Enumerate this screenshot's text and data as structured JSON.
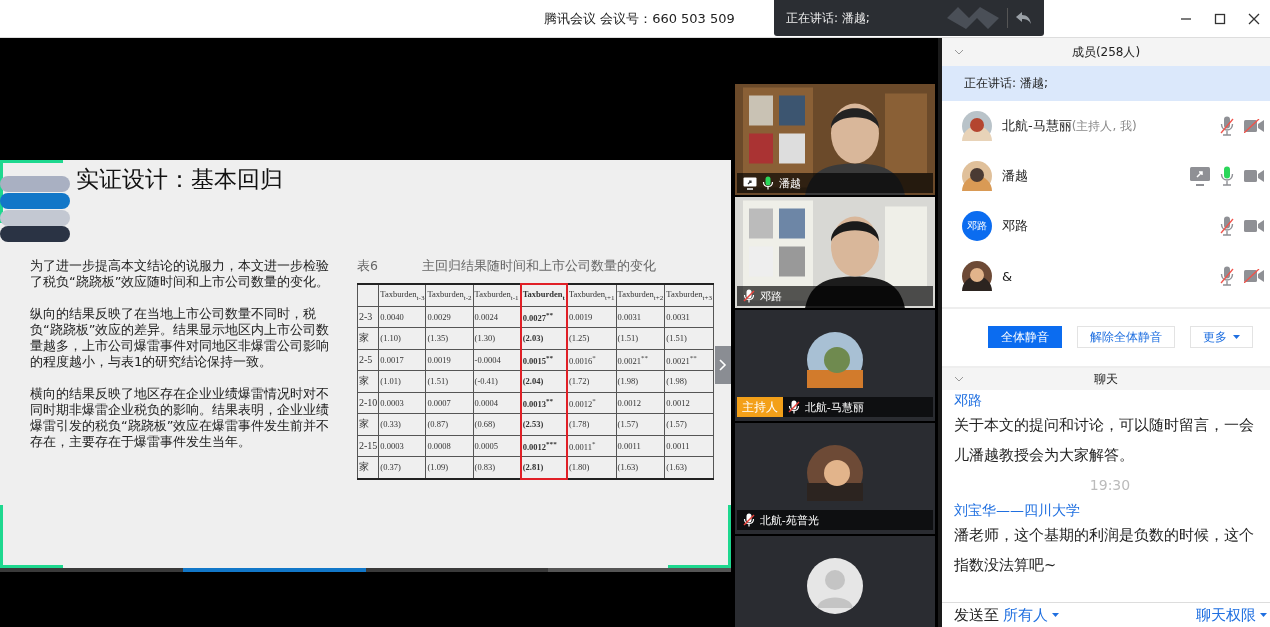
{
  "title_bar": {
    "title": "腾讯会议 会议号：660 503 509",
    "speaking_toast": "正在讲话: 潘越;"
  },
  "slide": {
    "title": "实证设计：基本回归",
    "paragraphs": [
      "为了进一步提高本文结论的说服力，本文进一步检验了税负“跷跷板”效应随时间和上市公司数量的变化。",
      "纵向的结果反映了在当地上市公司数量不同时，税负“跷跷板”效应的差异。结果显示地区内上市公司数量越多，上市公司爆雷事件对同地区非爆雷公司影响的程度越小，与表1的研究结论保持一致。",
      "横向的结果反映了地区存在企业业绩爆雷情况时对不同时期非爆雷企业税负的影响。结果表明，企业业绩爆雷引发的税负“跷跷板”效应在爆雷事件发生前并不存在，主要存在于爆雷事件发生当年。"
    ],
    "table": {
      "label": "表6",
      "caption": "主回归结果随时间和上市公司数量的变化",
      "columns": [
        {
          "label": "Taxburden$_{t-3}$",
          "highlighted": false
        },
        {
          "label": "Taxburden$_{t-2}$",
          "highlighted": false
        },
        {
          "label": "Taxburden$_{t-1}$",
          "highlighted": false
        },
        {
          "label": "Taxburden$_{t}$",
          "highlighted": true
        },
        {
          "label": "Taxburden$_{t+1}$",
          "highlighted": false
        },
        {
          "label": "Taxburden$_{t+2}$",
          "highlighted": false
        },
        {
          "label": "Taxburden$_{t+3}$",
          "highlighted": false
        }
      ],
      "rows": [
        {
          "label": "2-3",
          "cells": [
            "0.0040",
            "0.0029",
            "0.0024",
            "0.0027$^{**}$",
            "0.0019",
            "0.0031",
            "0.0031"
          ]
        },
        {
          "label": "家",
          "cells": [
            "(1.10)",
            "(1.35)",
            "(1.30)",
            "(2.03)",
            "(1.25)",
            "(1.51)",
            "(1.51)"
          ]
        },
        {
          "label": "2-5",
          "cells": [
            "0.0017",
            "0.0019",
            "-0.0004",
            "0.0015$^{**}$",
            "0.0016$^{*}$",
            "0.0021$^{**}$",
            "0.0021$^{**}$"
          ]
        },
        {
          "label": "家",
          "cells": [
            "(1.01)",
            "(1.51)",
            "(-0.41)",
            "(2.04)",
            "(1.72)",
            "(1.98)",
            "(1.98)"
          ]
        },
        {
          "label": "2-10",
          "cells": [
            "0.0003",
            "0.0007",
            "0.0004",
            "0.0013$^{**}$",
            "0.0012$^{*}$",
            "0.0012",
            "0.0012"
          ]
        },
        {
          "label": "家",
          "cells": [
            "(0.33)",
            "(0.87)",
            "(0.68)",
            "(2.53)",
            "(1.78)",
            "(1.57)",
            "(1.57)"
          ]
        },
        {
          "label": "2-15",
          "cells": [
            "0.0003",
            "0.0008",
            "0.0005",
            "0.0012$^{***}$",
            "0.0011$^{*}$",
            "0.0011",
            "0.0011"
          ]
        },
        {
          "label": "家",
          "cells": [
            "(0.37)",
            "(1.09)",
            "(0.83)",
            "(2.81)",
            "(1.80)",
            "(1.63)",
            "(1.63)"
          ]
        }
      ]
    }
  },
  "video_tiles": [
    {
      "kind": "camera",
      "name": "潘越",
      "sharing": true,
      "muted": false,
      "speaking": true
    },
    {
      "kind": "camera",
      "name": "邓路",
      "sharing": false,
      "muted": true,
      "speaking": false
    },
    {
      "kind": "avatar",
      "name": "北航-马慧丽",
      "badge": "主持人",
      "sharing": false,
      "muted": true,
      "speaking": false
    },
    {
      "kind": "avatar",
      "name": "北航-苑普光",
      "sharing": false,
      "muted": true,
      "speaking": false
    },
    {
      "kind": "default"
    }
  ],
  "members": {
    "title": "成员(258人)",
    "speaking": "正在讲话: 潘越;",
    "list": [
      {
        "name": "北航-马慧丽",
        "role": "(主持人, 我)",
        "sharing": false,
        "muted": true,
        "speaking": false,
        "camera": false
      },
      {
        "name": "潘越",
        "sharing": true,
        "muted": false,
        "speaking": true,
        "camera": true
      },
      {
        "name": "邓路",
        "avatar_text": "邓路",
        "sharing": false,
        "muted": true,
        "speaking": false,
        "camera": true
      },
      {
        "name": "&",
        "sharing": false,
        "muted": true,
        "speaking": false,
        "camera": false
      }
    ],
    "actions": [
      {
        "label": "全体静音",
        "primary": true,
        "dropdown": false
      },
      {
        "label": "解除全体静音",
        "primary": false,
        "dropdown": false
      },
      {
        "label": "更多",
        "primary": false,
        "dropdown": true
      }
    ]
  },
  "chat": {
    "title": "聊天",
    "items": [
      {
        "kind": "message",
        "sender": "邓路",
        "text": "关于本文的提问和讨论，可以随时留言，一会儿潘越教授会为大家解答。"
      },
      {
        "kind": "time",
        "text": "19:30"
      },
      {
        "kind": "message",
        "sender": "刘宝华——四川大学",
        "text": "潘老师，这个基期的利润是负数的时候，这个指数没法算吧~"
      }
    ],
    "send_label": "发送至",
    "recipient": "所有人",
    "permissions": "聊天权限"
  }
}
